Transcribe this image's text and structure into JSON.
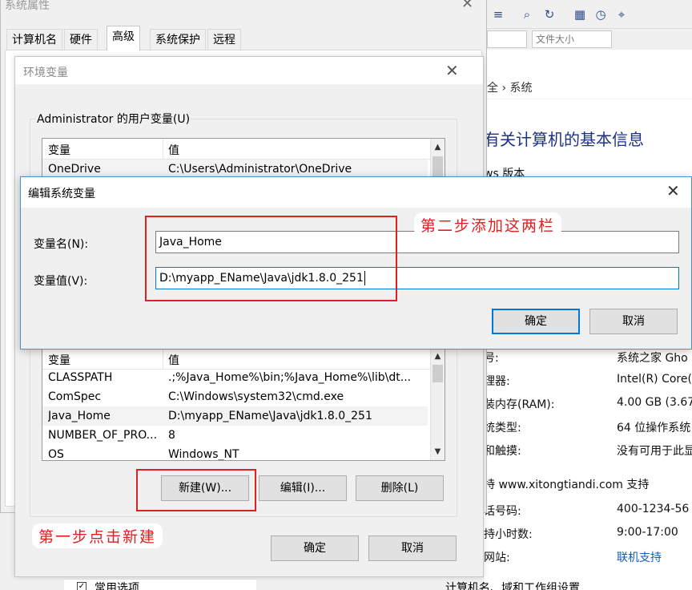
{
  "system_properties": {
    "title": "系统属性",
    "tabs": [
      "计算机名",
      "硬件",
      "高级",
      "系统保护",
      "远程"
    ],
    "active_tab": "高级"
  },
  "env_vars": {
    "title": "环境变量",
    "user_section_label": "Administrator 的用户变量(U)",
    "col_variable": "变量",
    "col_value": "值",
    "user_rows": [
      {
        "name": "OneDrive",
        "value": "C:\\Users\\Administrator\\OneDrive"
      }
    ],
    "system_rows": [
      {
        "name": "CLASSPATH",
        "value": ".;%Java_Home%\\bin;%Java_Home%\\lib\\dt..."
      },
      {
        "name": "ComSpec",
        "value": "C:\\Windows\\system32\\cmd.exe"
      },
      {
        "name": "Java_Home",
        "value": "D:\\myapp_EName\\Java\\jdk1.8.0_251"
      },
      {
        "name": "NUMBER_OF_PRO...",
        "value": "8"
      },
      {
        "name": "OS",
        "value": "Windows_NT"
      }
    ],
    "new_button": "新建(W)...",
    "edit_button": "编辑(I)...",
    "delete_button": "删除(L)",
    "ok_button": "确定",
    "cancel_button": "取消"
  },
  "edit_dialog": {
    "title": "编辑系统变量",
    "name_label": "变量名(N):",
    "value_label": "变量值(V):",
    "name_value": "Java_Home",
    "value_value": "D:\\myapp_EName\\Java\\jdk1.8.0_251",
    "ok_button": "确定",
    "cancel_button": "取消"
  },
  "annotations": {
    "step1": "第一步点击新建",
    "step2": "第二步添加这两栏",
    "color": "#e02020"
  },
  "background_window": {
    "combo_label": "文件大小",
    "breadcrumb": "全 › 系统",
    "heading": "有关计算机的基本信息",
    "edition": "ws 版本",
    "lines": [
      {
        "label": "号:",
        "value": "系统之家 Gho"
      },
      {
        "label": "理器:",
        "value": "Intel(R) Core("
      },
      {
        "label": "装内存(RAM):",
        "value": "4.00 GB (3.67"
      },
      {
        "label": "统类型:",
        "value": "64 位操作系统"
      },
      {
        "label": "和触摸:",
        "value": "没有可用于此显"
      }
    ],
    "support": "持 www.xitongtiandi.com 支持",
    "support_lines": [
      {
        "label": "话号码:",
        "value": "400-1234-56"
      },
      {
        "label": "持小时数:",
        "value": "9:00-17:00"
      },
      {
        "label": "网站:",
        "value": "联机支持"
      }
    ],
    "bottom_cut": "计算机名、域和工作组设置"
  },
  "bottom_tree": {
    "label": "常用选项"
  }
}
